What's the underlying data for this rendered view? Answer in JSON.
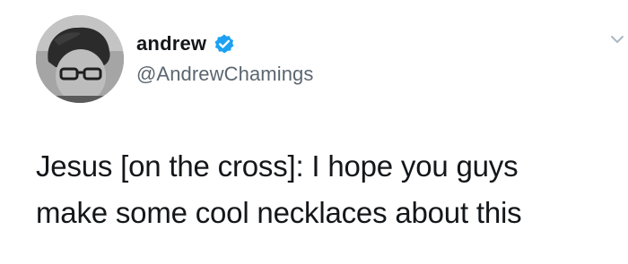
{
  "tweet": {
    "display_name": "andrew",
    "handle": "@AndrewChamings",
    "verified": true,
    "text_lines": [
      "Jesus [on the cross]: I hope you guys",
      "make some cool necklaces about this"
    ]
  },
  "icons": {
    "verified": "verified-badge-icon",
    "menu": "chevron-down-icon"
  },
  "colors": {
    "verified_blue": "#1da1f2",
    "name_text": "#14171a",
    "handle_text": "#5b6670"
  }
}
